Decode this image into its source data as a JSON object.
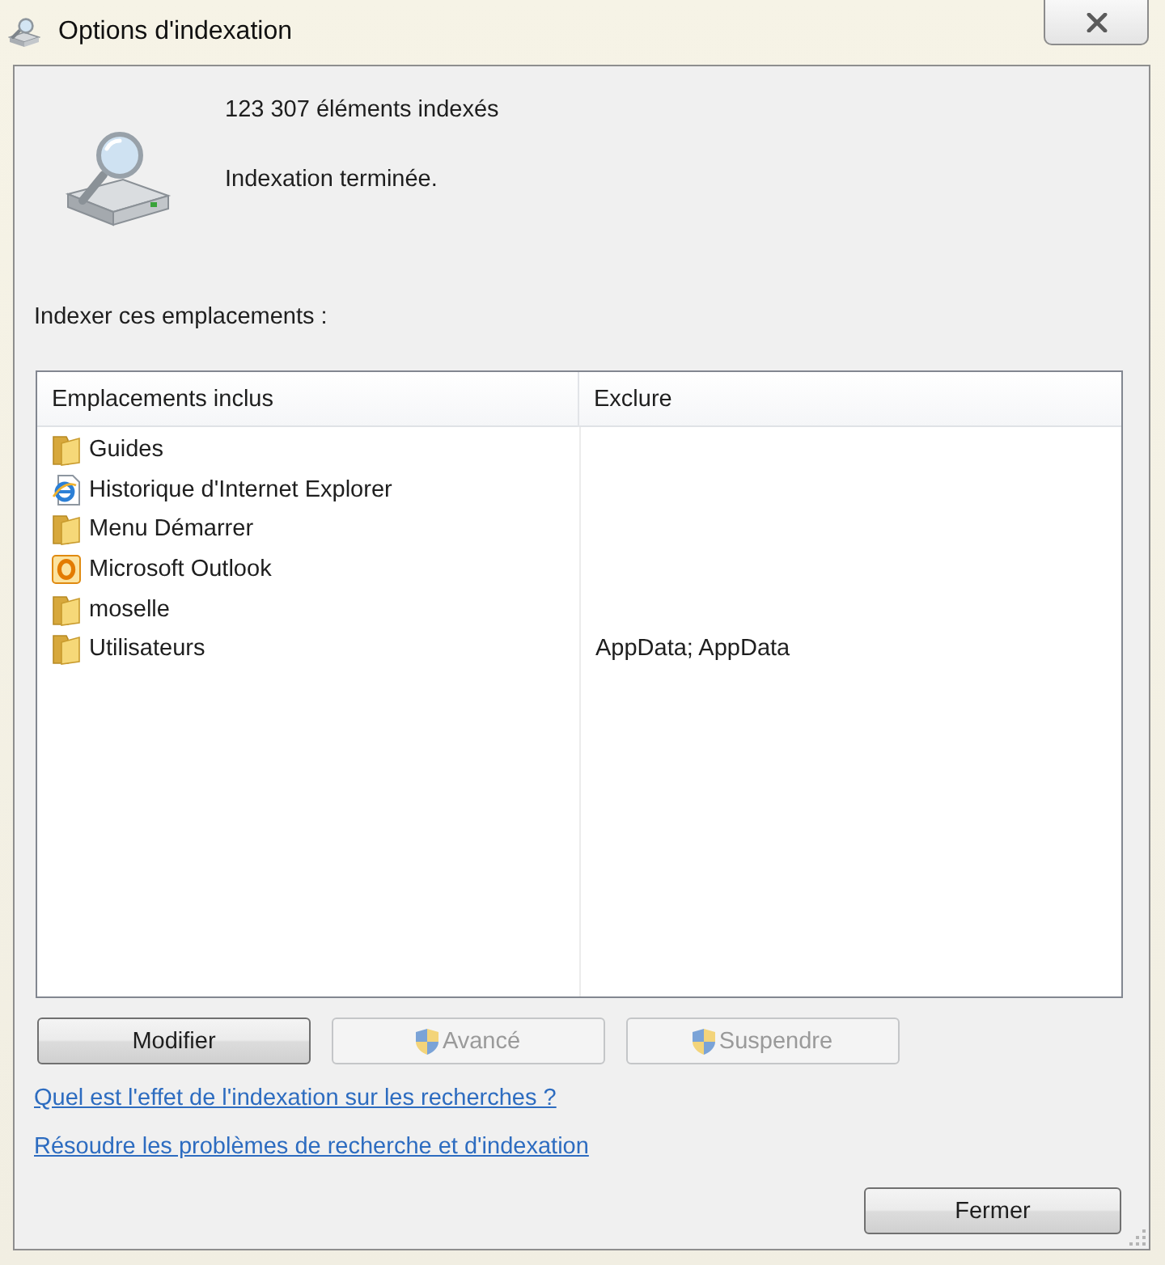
{
  "window": {
    "title": "Options d'indexation"
  },
  "summary": {
    "count": "123 307 éléments indexés",
    "status": "Indexation terminée."
  },
  "locations_label": "Indexer ces emplacements :",
  "table": {
    "columns": [
      "Emplacements inclus",
      "Exclure"
    ],
    "rows": [
      {
        "kind": "folder",
        "location": "Guides"
      },
      {
        "kind": "browser",
        "location": "Historique d'Internet Explorer"
      },
      {
        "kind": "folder",
        "location": "Menu Démarrer"
      },
      {
        "kind": "mail",
        "location": "Microsoft Outlook"
      },
      {
        "kind": "folder",
        "location": "moselle"
      },
      {
        "kind": "folder",
        "location": "Utilisateurs",
        "exclude": "AppData; AppData"
      }
    ]
  },
  "buttons": [
    {
      "label": "Modifier",
      "disabled": false,
      "shield": false
    },
    {
      "label": "Avancé",
      "disabled": true,
      "shield": true
    },
    {
      "label": "Suspendre",
      "disabled": true,
      "shield": true
    }
  ],
  "links": [
    "Quel est l'effet de l'indexation sur les recherches ?",
    "Résoudre les problèmes de recherche et d'indexation"
  ],
  "close_button": {
    "label": "Fermer"
  }
}
